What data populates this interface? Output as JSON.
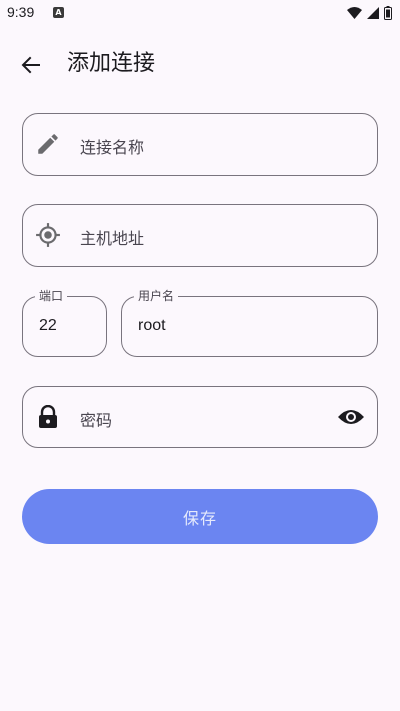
{
  "status_bar": {
    "time": "9:39",
    "app_icon_letter": "A",
    "icons": [
      "wifi-icon",
      "signal-icon",
      "battery-icon"
    ]
  },
  "app_bar": {
    "title": "添加连接",
    "back_icon": "arrow-back-icon"
  },
  "form": {
    "connection_name": {
      "placeholder": "连接名称",
      "value": "",
      "icon": "pencil-icon"
    },
    "host": {
      "placeholder": "主机地址",
      "value": "",
      "icon": "crosshair-icon"
    },
    "port": {
      "label": "端口",
      "value": "22"
    },
    "username": {
      "label": "用户名",
      "value": "root"
    },
    "password": {
      "placeholder": "密码",
      "value": "",
      "icon": "lock-icon",
      "toggle_icon": "eye-icon"
    }
  },
  "save_button": {
    "label": "保存"
  },
  "colors": {
    "background": "#fcf8fd",
    "outline": "#79747e",
    "primary_disabled": "#6b85f1",
    "text": "#1c1b1f"
  }
}
